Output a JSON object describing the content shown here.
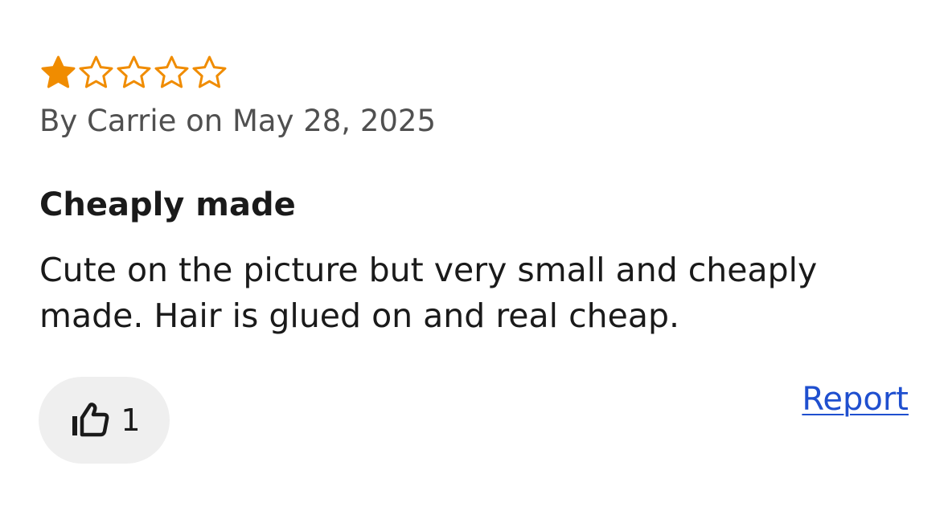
{
  "review": {
    "rating": 1,
    "rating_max": 5,
    "star_color": "#f08c00",
    "star_icon": "star-icon",
    "byline": "By Carrie on May 28, 2025",
    "title": "Cheaply made",
    "body": "Cute on the picture but very small and cheaply made. Hair is glued on and real cheap.",
    "helpful": {
      "icon": "thumbs-up-icon",
      "count": "1"
    },
    "report_label": "Report",
    "link_color": "#1f4fcf"
  }
}
